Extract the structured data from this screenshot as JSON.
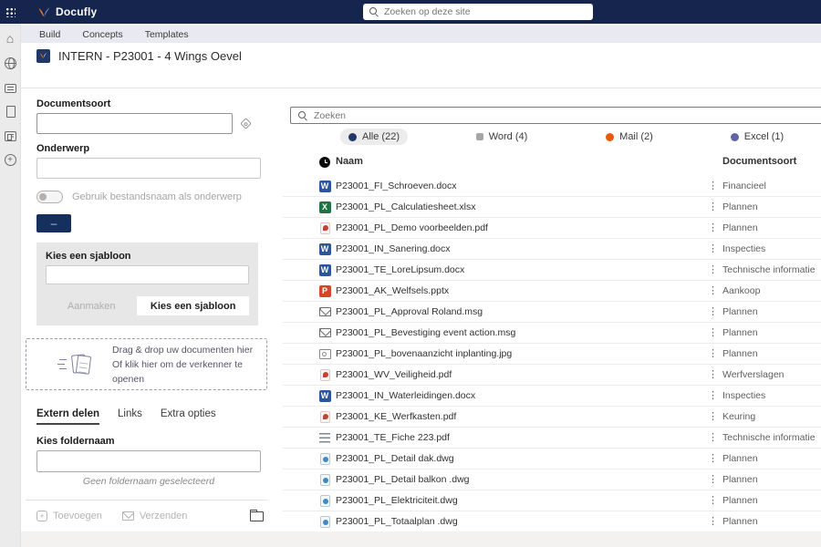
{
  "topbar": {
    "app_name": "Docufly",
    "search_placeholder": "Zoeken op deze site"
  },
  "nav": {
    "items": [
      "Build",
      "Concepts",
      "Templates"
    ]
  },
  "site_header": {
    "title": "INTERN - P23001 - 4 Wings Oevel"
  },
  "colors": {
    "topbar_bg": "#15254e",
    "accent_navy": "#16305e"
  },
  "form": {
    "documentsoort_label": "Documentsoort",
    "onderwerp_label": "Onderwerp",
    "toggle_label": "Gebruik bestandsnaam als onderwerp",
    "dash_button_label": "–",
    "sjabloon": {
      "label": "Kies een sjabloon",
      "aanmaken_label": "Aanmaken",
      "kies_label": "Kies een sjabloon"
    },
    "dropzone": {
      "line1": "Drag & drop uw documenten hier",
      "line2": "Of klik hier om de verkenner te openen"
    },
    "tabs": [
      "Extern delen",
      "Links",
      "Extra opties"
    ],
    "foldernaam_label": "Kies foldernaam",
    "foldernaam_hint": "Geen foldernaam geselecteerd",
    "toevoegen_label": "Toevoegen",
    "verzenden_label": "Verzenden"
  },
  "documents": {
    "search_placeholder": "Zoeken",
    "filters": [
      {
        "label": "Alle (22)",
        "color": "#1f3864",
        "shape": "circle",
        "active": true
      },
      {
        "label": "Word (4)",
        "color": "#a6a6a6",
        "shape": "square",
        "active": false
      },
      {
        "label": "Mail (2)",
        "color": "#e8590c",
        "shape": "circle",
        "active": false
      },
      {
        "label": "Excel (1)",
        "color": "#6264a7",
        "shape": "circle",
        "active": false
      }
    ],
    "columns": {
      "naam": "Naam",
      "documentsoort": "Documentsoort"
    },
    "icon_colors": {
      "word": "#2b579a",
      "excel": "#217346",
      "ppt": "#d24726",
      "pdf": "#c8402f",
      "mail": "#6d6b69",
      "image": "#8a8886",
      "list": "#7b8794",
      "dwg": "#3e8ac2"
    },
    "rows": [
      {
        "icon": "word",
        "name": "P23001_FI_Schroeven.docx",
        "type": "Financieel"
      },
      {
        "icon": "excel",
        "name": "P23001_PL_Calculatiesheet.xlsx",
        "type": "Plannen"
      },
      {
        "icon": "pdf",
        "name": "P23001_PL_Demo voorbeelden.pdf",
        "type": "Plannen"
      },
      {
        "icon": "word",
        "name": "P23001_IN_Sanering.docx",
        "type": "Inspecties"
      },
      {
        "icon": "word",
        "name": "P23001_TE_LoreLipsum.docx",
        "type": "Technische informatie"
      },
      {
        "icon": "ppt",
        "name": "P23001_AK_Welfsels.pptx",
        "type": "Aankoop"
      },
      {
        "icon": "mail",
        "name": "P23001_PL_Approval Roland.msg",
        "type": "Plannen"
      },
      {
        "icon": "mail",
        "name": "P23001_PL_Bevestiging event action.msg",
        "type": "Plannen"
      },
      {
        "icon": "image",
        "name": "P23001_PL_bovenaanzicht inplanting.jpg",
        "type": "Plannen"
      },
      {
        "icon": "pdf",
        "name": "P23001_WV_Veiligheid.pdf",
        "type": "Werfverslagen"
      },
      {
        "icon": "word",
        "name": "P23001_IN_Waterleidingen.docx",
        "type": "Inspecties"
      },
      {
        "icon": "pdf",
        "name": "P23001_KE_Werfkasten.pdf",
        "type": "Keuring"
      },
      {
        "icon": "list",
        "name": "P23001_TE_Fiche 223.pdf",
        "type": "Technische informatie"
      },
      {
        "icon": "dwg",
        "name": "P23001_PL_Detail dak.dwg",
        "type": "Plannen"
      },
      {
        "icon": "dwg",
        "name": "P23001_PL_Detail balkon .dwg",
        "type": "Plannen"
      },
      {
        "icon": "dwg",
        "name": "P23001_PL_Elektriciteit.dwg",
        "type": "Plannen"
      },
      {
        "icon": "dwg",
        "name": "P23001_PL_Totaalplan .dwg",
        "type": "Plannen"
      }
    ]
  }
}
